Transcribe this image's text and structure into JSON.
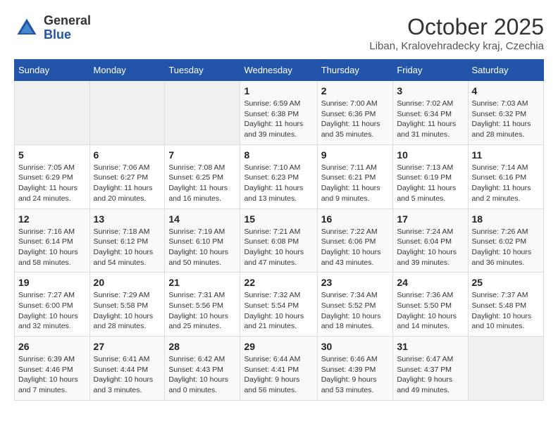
{
  "header": {
    "logo_line1": "General",
    "logo_line2": "Blue",
    "month": "October 2025",
    "location": "Liban, Kralovehradecky kraj, Czechia"
  },
  "days_of_week": [
    "Sunday",
    "Monday",
    "Tuesday",
    "Wednesday",
    "Thursday",
    "Friday",
    "Saturday"
  ],
  "weeks": [
    [
      {
        "day": "",
        "info": ""
      },
      {
        "day": "",
        "info": ""
      },
      {
        "day": "",
        "info": ""
      },
      {
        "day": "1",
        "info": "Sunrise: 6:59 AM\nSunset: 6:38 PM\nDaylight: 11 hours\nand 39 minutes."
      },
      {
        "day": "2",
        "info": "Sunrise: 7:00 AM\nSunset: 6:36 PM\nDaylight: 11 hours\nand 35 minutes."
      },
      {
        "day": "3",
        "info": "Sunrise: 7:02 AM\nSunset: 6:34 PM\nDaylight: 11 hours\nand 31 minutes."
      },
      {
        "day": "4",
        "info": "Sunrise: 7:03 AM\nSunset: 6:32 PM\nDaylight: 11 hours\nand 28 minutes."
      }
    ],
    [
      {
        "day": "5",
        "info": "Sunrise: 7:05 AM\nSunset: 6:29 PM\nDaylight: 11 hours\nand 24 minutes."
      },
      {
        "day": "6",
        "info": "Sunrise: 7:06 AM\nSunset: 6:27 PM\nDaylight: 11 hours\nand 20 minutes."
      },
      {
        "day": "7",
        "info": "Sunrise: 7:08 AM\nSunset: 6:25 PM\nDaylight: 11 hours\nand 16 minutes."
      },
      {
        "day": "8",
        "info": "Sunrise: 7:10 AM\nSunset: 6:23 PM\nDaylight: 11 hours\nand 13 minutes."
      },
      {
        "day": "9",
        "info": "Sunrise: 7:11 AM\nSunset: 6:21 PM\nDaylight: 11 hours\nand 9 minutes."
      },
      {
        "day": "10",
        "info": "Sunrise: 7:13 AM\nSunset: 6:19 PM\nDaylight: 11 hours\nand 5 minutes."
      },
      {
        "day": "11",
        "info": "Sunrise: 7:14 AM\nSunset: 6:16 PM\nDaylight: 11 hours\nand 2 minutes."
      }
    ],
    [
      {
        "day": "12",
        "info": "Sunrise: 7:16 AM\nSunset: 6:14 PM\nDaylight: 10 hours\nand 58 minutes."
      },
      {
        "day": "13",
        "info": "Sunrise: 7:18 AM\nSunset: 6:12 PM\nDaylight: 10 hours\nand 54 minutes."
      },
      {
        "day": "14",
        "info": "Sunrise: 7:19 AM\nSunset: 6:10 PM\nDaylight: 10 hours\nand 50 minutes."
      },
      {
        "day": "15",
        "info": "Sunrise: 7:21 AM\nSunset: 6:08 PM\nDaylight: 10 hours\nand 47 minutes."
      },
      {
        "day": "16",
        "info": "Sunrise: 7:22 AM\nSunset: 6:06 PM\nDaylight: 10 hours\nand 43 minutes."
      },
      {
        "day": "17",
        "info": "Sunrise: 7:24 AM\nSunset: 6:04 PM\nDaylight: 10 hours\nand 39 minutes."
      },
      {
        "day": "18",
        "info": "Sunrise: 7:26 AM\nSunset: 6:02 PM\nDaylight: 10 hours\nand 36 minutes."
      }
    ],
    [
      {
        "day": "19",
        "info": "Sunrise: 7:27 AM\nSunset: 6:00 PM\nDaylight: 10 hours\nand 32 minutes."
      },
      {
        "day": "20",
        "info": "Sunrise: 7:29 AM\nSunset: 5:58 PM\nDaylight: 10 hours\nand 28 minutes."
      },
      {
        "day": "21",
        "info": "Sunrise: 7:31 AM\nSunset: 5:56 PM\nDaylight: 10 hours\nand 25 minutes."
      },
      {
        "day": "22",
        "info": "Sunrise: 7:32 AM\nSunset: 5:54 PM\nDaylight: 10 hours\nand 21 minutes."
      },
      {
        "day": "23",
        "info": "Sunrise: 7:34 AM\nSunset: 5:52 PM\nDaylight: 10 hours\nand 18 minutes."
      },
      {
        "day": "24",
        "info": "Sunrise: 7:36 AM\nSunset: 5:50 PM\nDaylight: 10 hours\nand 14 minutes."
      },
      {
        "day": "25",
        "info": "Sunrise: 7:37 AM\nSunset: 5:48 PM\nDaylight: 10 hours\nand 10 minutes."
      }
    ],
    [
      {
        "day": "26",
        "info": "Sunrise: 6:39 AM\nSunset: 4:46 PM\nDaylight: 10 hours\nand 7 minutes."
      },
      {
        "day": "27",
        "info": "Sunrise: 6:41 AM\nSunset: 4:44 PM\nDaylight: 10 hours\nand 3 minutes."
      },
      {
        "day": "28",
        "info": "Sunrise: 6:42 AM\nSunset: 4:43 PM\nDaylight: 10 hours\nand 0 minutes."
      },
      {
        "day": "29",
        "info": "Sunrise: 6:44 AM\nSunset: 4:41 PM\nDaylight: 9 hours\nand 56 minutes."
      },
      {
        "day": "30",
        "info": "Sunrise: 6:46 AM\nSunset: 4:39 PM\nDaylight: 9 hours\nand 53 minutes."
      },
      {
        "day": "31",
        "info": "Sunrise: 6:47 AM\nSunset: 4:37 PM\nDaylight: 9 hours\nand 49 minutes."
      },
      {
        "day": "",
        "info": ""
      }
    ]
  ]
}
